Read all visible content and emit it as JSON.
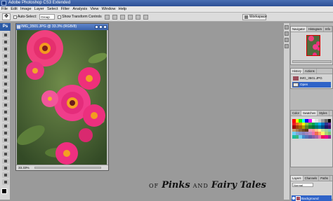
{
  "window": {
    "title": "Adobe Photoshop CS3 Extended"
  },
  "menu": [
    "File",
    "Edit",
    "Image",
    "Layer",
    "Select",
    "Filter",
    "Analysis",
    "View",
    "Window",
    "Help"
  ],
  "options": {
    "auto_select_label": "Auto-Select:",
    "auto_select_value": "Group",
    "transform_label": "Show Transform Controls",
    "workspace_label": "Workspace"
  },
  "toolbox": {
    "logo": "Ps"
  },
  "document": {
    "title": "IMG_3501.JPG @ 33.3% (RGB/8)",
    "zoom": "33.33%"
  },
  "panels": {
    "navigator_tabs": [
      "Navigator",
      "Histogram",
      "Info"
    ],
    "history_tabs": [
      "History",
      "Actions"
    ],
    "history_items": [
      "IMG_3501.JPG",
      "Open"
    ],
    "color_tabs": [
      "Color",
      "Swatches",
      "Styles"
    ],
    "layers_tabs": [
      "Layers",
      "Channels",
      "Paths"
    ],
    "blend_mode": "Normal",
    "layer_name": "Background"
  },
  "swatch_colors": [
    "#ff0000",
    "#ffff00",
    "#00ff00",
    "#00ffff",
    "#0000ff",
    "#ff00ff",
    "#ffffff",
    "#e6e6e6",
    "#cccccc",
    "#999999",
    "#666666",
    "#000000",
    "#ed1c24",
    "#f26522",
    "#f7941d",
    "#fff200",
    "#8dc63f",
    "#39b54a",
    "#00a651",
    "#00a99d",
    "#00aeef",
    "#0072bc",
    "#2e3192",
    "#662d91",
    "#9e0b0f",
    "#a0410d",
    "#a36209",
    "#aba000",
    "#598527",
    "#197b30",
    "#007236",
    "#00746b",
    "#0076a3",
    "#004a80",
    "#1b1464",
    "#440e62",
    "#c69c6d",
    "#a67c52",
    "#8c6239",
    "#754c24",
    "#603913",
    "#f49ac1",
    "#f5989d",
    "#fdc689",
    "#fff799",
    "#c4df9b",
    "#a2d39c",
    "#7accc8",
    "#6dcff6",
    "#7da7d9",
    "#8393ca",
    "#8781bd",
    "#a186be",
    "#bd8cbf",
    "#f06eaa",
    "#f26c4f",
    "#fbaf5d",
    "#fff568",
    "#acd373",
    "#7cc576",
    "#1abc9c",
    "#3bb878",
    "#6dcff6",
    "#448ccb",
    "#5674b9",
    "#605ca8",
    "#855fa8",
    "#a864a8",
    "#f06eaa",
    "#ed145b",
    "#ec008c",
    "#92278f"
  ],
  "watermark": {
    "of": "OF",
    "pinks": "Pinks",
    "and": "AND",
    "fairy": "Fairy Tales"
  }
}
